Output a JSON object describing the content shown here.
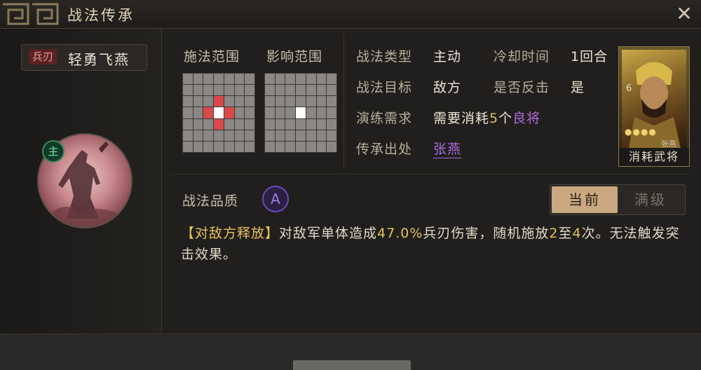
{
  "window": {
    "title": "战法传承",
    "close_icon": "close-icon"
  },
  "skill": {
    "type_tag": "兵刃",
    "name": "轻勇飞燕",
    "role_badge": "主"
  },
  "ranges": {
    "cast_label": "施法范围",
    "effect_label": "影响范围"
  },
  "info": {
    "type_label": "战法类型",
    "type_value": "主动",
    "cooldown_label": "冷却时间",
    "cooldown_value": "1回合",
    "target_label": "战法目标",
    "target_value": "敌方",
    "counter_label": "是否反击",
    "counter_value": "是",
    "req_label": "演练需求",
    "req_prefix": "需要消耗",
    "req_count": "5",
    "req_unit": "个",
    "req_item": "良将",
    "origin_label": "传承出处",
    "origin_value": "张燕"
  },
  "hero_card": {
    "caption": "消耗武将",
    "level": "6",
    "name": "张燕"
  },
  "quality": {
    "label": "战法品质",
    "grade": "A"
  },
  "toggle": {
    "current": "当前",
    "max": "满级"
  },
  "description": {
    "tag": "【对敌方释放】",
    "p1": "对敌军单体造成",
    "pct": "47.0%",
    "p2": "兵刃伤害，随机施放",
    "n1": "2",
    "p3": "至",
    "n2": "4",
    "p4": "次。无法触发突击效果。"
  },
  "colors": {
    "accent_gold": "#e6c25a",
    "accent_purple": "#b06ae0",
    "danger_red": "#d84a4a"
  }
}
